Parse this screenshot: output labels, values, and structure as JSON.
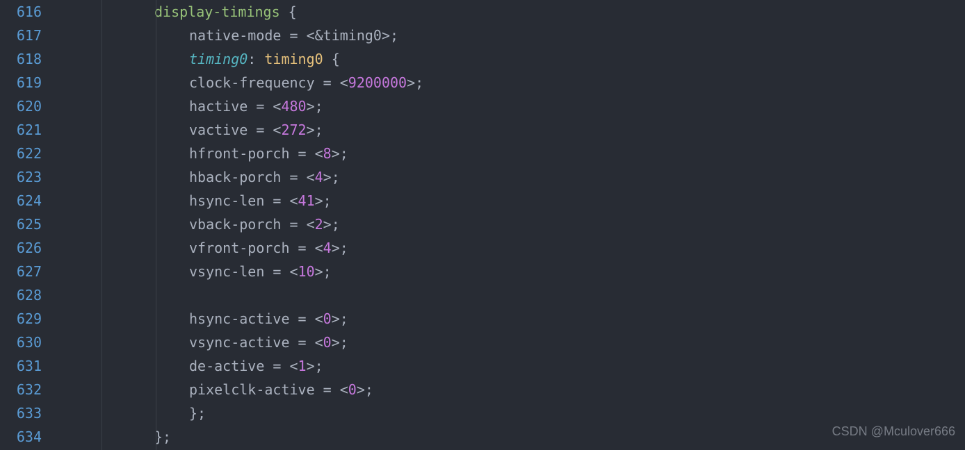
{
  "watermark": "CSDN @Mculover666",
  "lines": [
    616,
    617,
    618,
    619,
    620,
    621,
    622,
    623,
    624,
    625,
    626,
    627,
    628,
    629,
    630,
    631,
    632,
    633,
    634
  ],
  "code": {
    "block_name": "display-timings",
    "label": "timing0",
    "node_name": "timing0",
    "native_mode_prop": "native-mode",
    "native_mode_val": "&timing0",
    "props": [
      {
        "name": "clock-frequency",
        "val": "9200000"
      },
      {
        "name": "hactive",
        "val": "480"
      },
      {
        "name": "vactive",
        "val": "272"
      },
      {
        "name": "hfront-porch",
        "val": "8"
      },
      {
        "name": "hback-porch",
        "val": "4"
      },
      {
        "name": "hsync-len",
        "val": "41"
      },
      {
        "name": "vback-porch",
        "val": "2"
      },
      {
        "name": "vfront-porch",
        "val": "4"
      },
      {
        "name": "vsync-len",
        "val": "10"
      }
    ],
    "props2": [
      {
        "name": "hsync-active",
        "val": "0"
      },
      {
        "name": "vsync-active",
        "val": "0"
      },
      {
        "name": "de-active",
        "val": "1"
      },
      {
        "name": "pixelclk-active",
        "val": "0"
      }
    ],
    "brace_open": " {",
    "brace_close": "};",
    "eq": " = <",
    "gt_semi": ">;",
    "colon": ":"
  }
}
